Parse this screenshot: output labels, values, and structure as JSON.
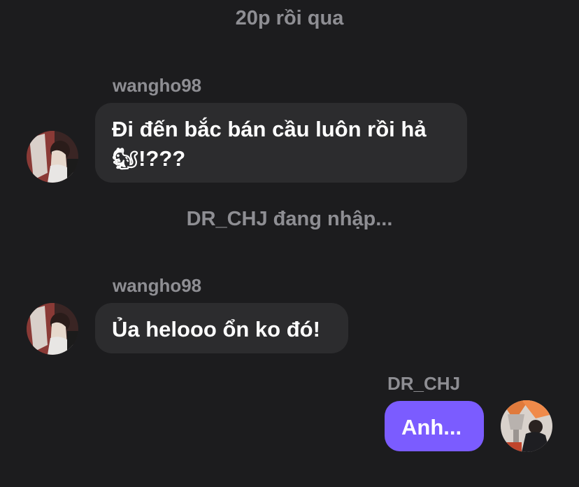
{
  "header": {
    "timestamp": "20p rồi qua"
  },
  "messages": [
    {
      "sender": "wangho98",
      "line1": "Đi đến bắc bán cầu luôn rồi hả",
      "emoji": "🐿",
      "line2_suffix": "!???"
    },
    {
      "sender": "wangho98",
      "text": "Ủa helooo ổn ko đó!"
    },
    {
      "sender": "DR_CHJ",
      "text": "Anh..."
    }
  ],
  "typing_indicator": "DR_CHJ đang nhập...",
  "colors": {
    "background": "#1c1c1e",
    "incoming_bubble": "#2c2c2e",
    "outgoing_bubble": "#7b5cff",
    "muted_text": "#8e8e93"
  }
}
